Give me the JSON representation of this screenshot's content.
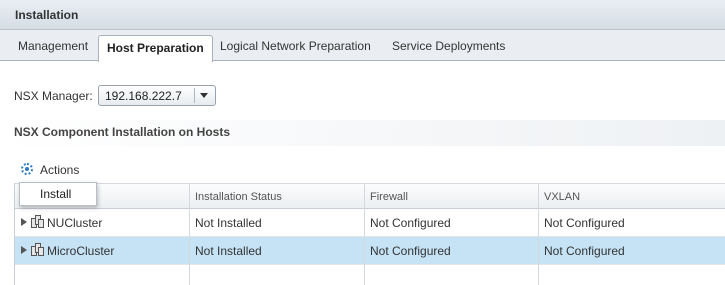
{
  "panel": {
    "title": "Installation"
  },
  "tabs": [
    {
      "label": "Management",
      "active": false
    },
    {
      "label": "Host Preparation",
      "active": true
    },
    {
      "label": "Logical Network Preparation",
      "active": false
    },
    {
      "label": "Service Deployments",
      "active": false
    }
  ],
  "manager": {
    "label": "NSX Manager:",
    "selected": "192.168.222.7"
  },
  "section": {
    "title": "NSX Component Installation on Hosts"
  },
  "toolbar": {
    "actions_label": "Actions",
    "actions_icon": "gear-icon"
  },
  "menu": {
    "install_label": "Install"
  },
  "table": {
    "columns": [
      "",
      "Installation Status",
      "Firewall",
      "VXLAN"
    ],
    "rows": [
      {
        "name": "NUCluster",
        "status": "Not Installed",
        "firewall": "Not Configured",
        "vxlan": "Not Configured",
        "selected": false
      },
      {
        "name": "MicroCluster",
        "status": "Not Installed",
        "firewall": "Not Configured",
        "vxlan": "Not Configured",
        "selected": true
      }
    ]
  },
  "colors": {
    "selected_row": "#c5e3f5",
    "accent": "#2e7bc2"
  }
}
